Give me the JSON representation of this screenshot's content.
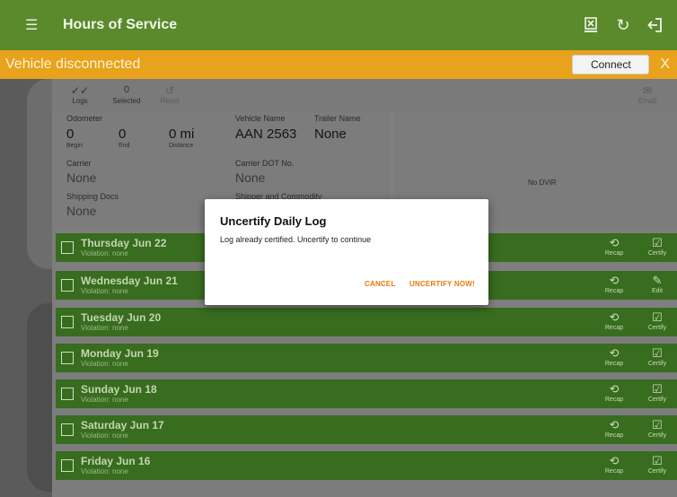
{
  "appbar": {
    "title": "Hours of Service",
    "menu_icon": "hamburger-icon",
    "actions": [
      "sync-icon",
      "refresh-icon",
      "logout-icon"
    ]
  },
  "banner": {
    "message": "Vehicle disconnected",
    "connect_label": "Connect",
    "close_label": "X"
  },
  "toolbar": {
    "logs_label": "Logs",
    "selected_count": "0",
    "selected_label": "Selected",
    "reset_label": "Reset",
    "email_label": "Email"
  },
  "summary": {
    "odometer_label": "Odometer",
    "begin_value": "0",
    "begin_label": "Begin",
    "end_value": "0",
    "end_label": "End",
    "distance_value": "0 mi",
    "distance_label": "Distance",
    "vehicle_name_label": "Vehicle Name",
    "vehicle_name_value": "AAN 2563",
    "trailer_name_label": "Trailer Name",
    "trailer_name_value": "None",
    "carrier_label": "Carrier",
    "carrier_value": "None",
    "carrier_dot_label": "Carrier DOT No.",
    "carrier_dot_value": "None",
    "shipping_docs_label": "Shipping Docs",
    "shipping_docs_value": "None",
    "shipper_label": "Shipper and Commodity",
    "dvir_text": "No DVIR"
  },
  "logs": [
    {
      "date": "Thursday Jun 22",
      "violation": "Violation: none",
      "recap": "Recap",
      "action": "Certify"
    },
    {
      "date": "Wednesday Jun 21",
      "violation": "Violation: none",
      "recap": "Recap",
      "action": "Edit"
    },
    {
      "date": "Tuesday Jun 20",
      "violation": "Violation: none",
      "recap": "Recap",
      "action": "Certify"
    },
    {
      "date": "Monday Jun 19",
      "violation": "Violation: none",
      "recap": "Recap",
      "action": "Certify"
    },
    {
      "date": "Sunday Jun 18",
      "violation": "Violation: none",
      "recap": "Recap",
      "action": "Certify"
    },
    {
      "date": "Saturday Jun 17",
      "violation": "Violation: none",
      "recap": "Recap",
      "action": "Certify"
    },
    {
      "date": "Friday Jun 16",
      "violation": "Violation: none",
      "recap": "Recap",
      "action": "Certify"
    }
  ],
  "dialog": {
    "title": "Uncertify Daily Log",
    "message": "Log already certified. Uncertify to continue",
    "cancel_label": "CANCEL",
    "confirm_label": "UNCERTIFY NOW!"
  },
  "colors": {
    "appbar": "#5a8a2c",
    "banner": "#e8a21b",
    "row": "#386c1f",
    "accent": "#e8780c"
  }
}
